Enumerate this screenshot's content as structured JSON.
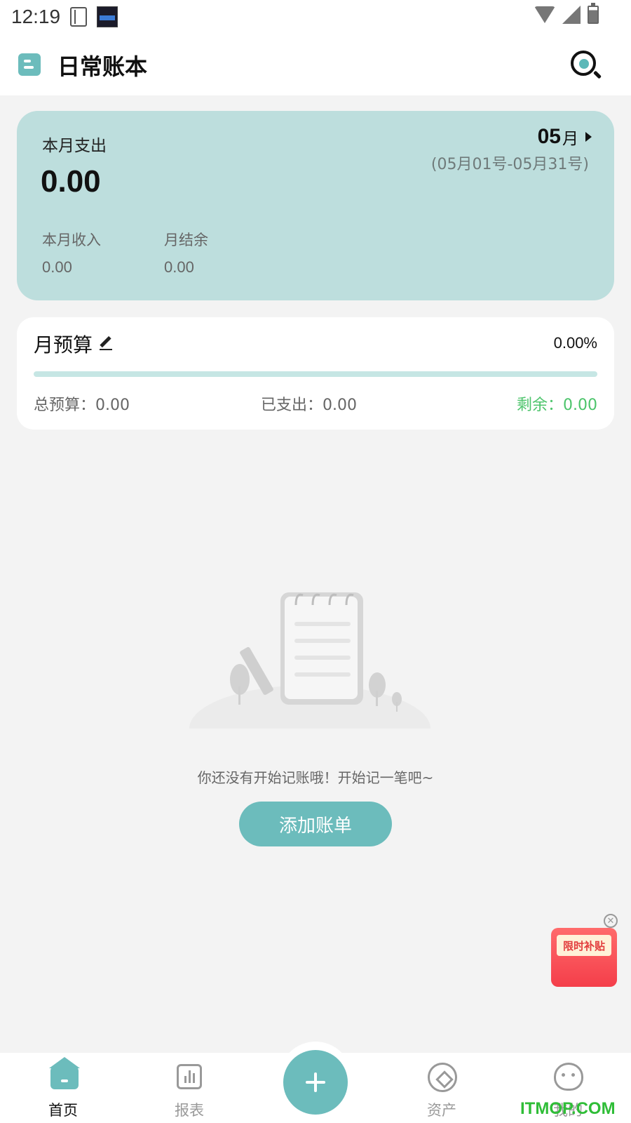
{
  "status_bar": {
    "time": "12:19"
  },
  "header": {
    "title": "日常账本"
  },
  "summary": {
    "label": "本月支出",
    "amount": "0.00",
    "month_num": "05",
    "month_suffix": "月",
    "range": "(05月01号-05月31号)",
    "income_label": "本月收入",
    "income_value": "0.00",
    "balance_label": "月结余",
    "balance_value": "0.00"
  },
  "budget": {
    "title": "月预算",
    "percent": "0.00%",
    "progress": 0.0,
    "total": "总预算：0.00",
    "spent": "已支出：0.00",
    "remaining": "剩余：0.00"
  },
  "empty_state": {
    "message": "你还没有开始记账哦！开始记一笔吧~",
    "button_label": "添加账单"
  },
  "promo": {
    "label": "限时补贴"
  },
  "nav": {
    "items": [
      {
        "label": "首页"
      },
      {
        "label": "报表"
      },
      {
        "label": "资产"
      },
      {
        "label": "我的"
      }
    ]
  },
  "watermark": "ITMOP.COM",
  "colors": {
    "accent": "#6cbcbc",
    "card_bg": "#bddedd",
    "remaining": "#4cc46b",
    "promo": "#f43e4a"
  }
}
